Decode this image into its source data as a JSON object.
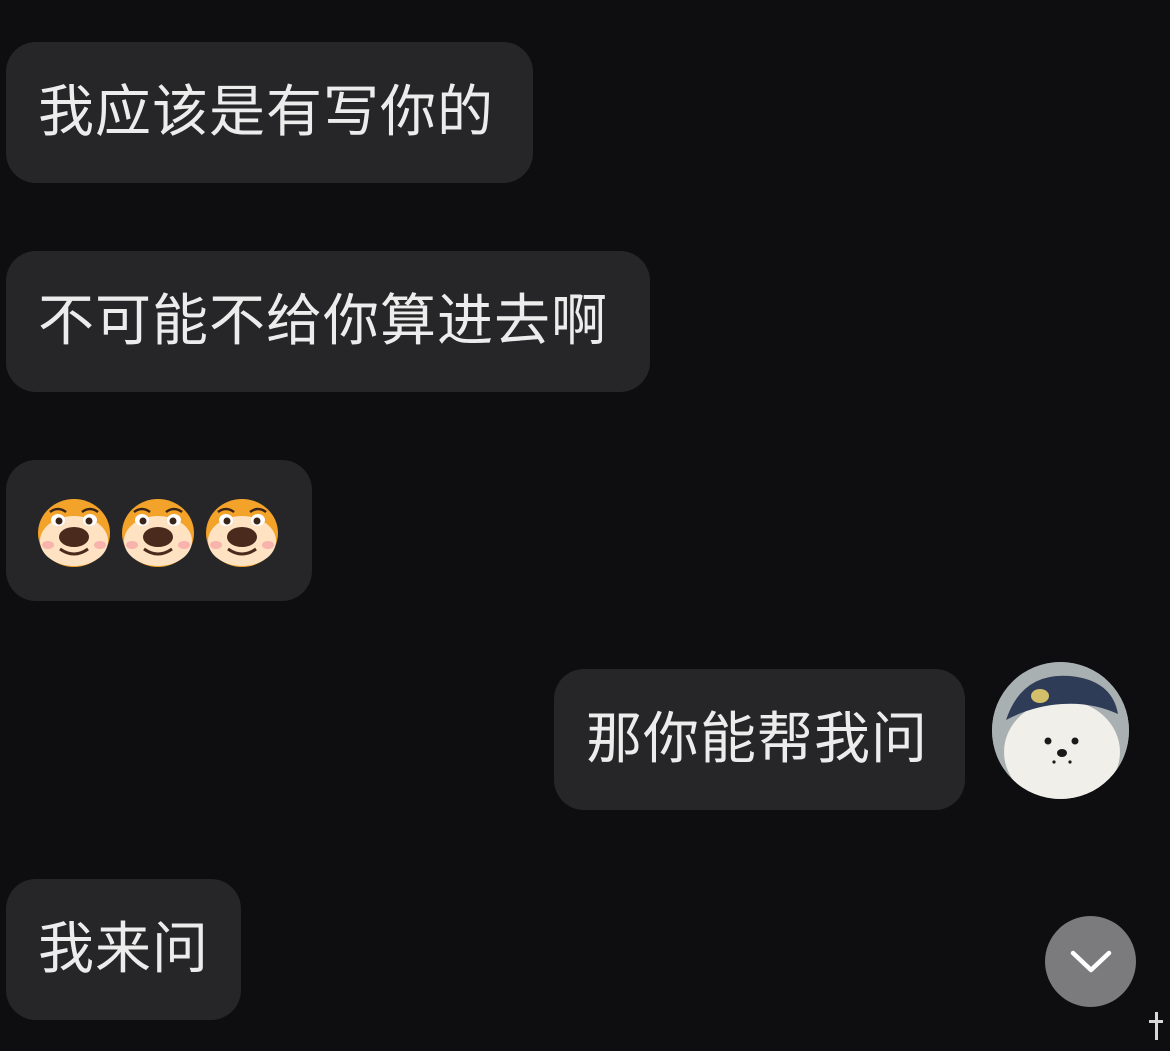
{
  "messages": [
    {
      "id": "m1",
      "side": "left",
      "text": "我应该是有写你的"
    },
    {
      "id": "m2",
      "side": "left",
      "text": "不可能不给你算进去啊"
    },
    {
      "id": "m3",
      "side": "left",
      "emojis": [
        "dog-emoji",
        "dog-emoji",
        "dog-emoji"
      ]
    },
    {
      "id": "m4",
      "side": "right",
      "text": "那你能帮我问"
    },
    {
      "id": "m5",
      "side": "left",
      "text": "我来问"
    }
  ],
  "avatar": {
    "icon": "white-dog-blue-cap-avatar"
  },
  "scroll_button": {
    "icon": "chevron-down-icon"
  },
  "colors": {
    "background": "#0e0e10",
    "bubble": "#262628",
    "text": "#ececec",
    "scroll_button": "#7b7b7d"
  }
}
